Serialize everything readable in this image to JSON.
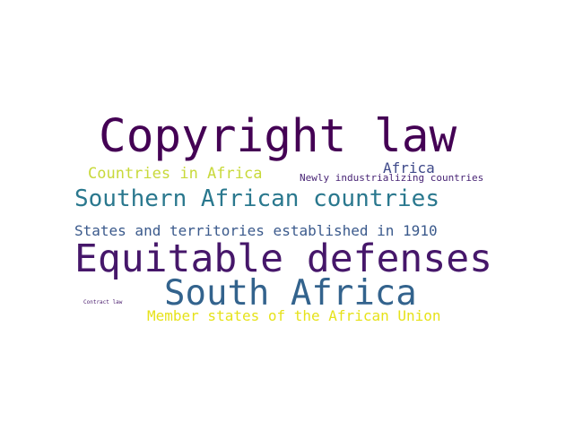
{
  "words": {
    "copyright_law": {
      "text": "Copyright law",
      "color": "#440154"
    },
    "countries_in_africa": {
      "text": "Countries in Africa",
      "color": "#c8d93a"
    },
    "africa": {
      "text": "Africa",
      "color": "#3f4a8a"
    },
    "newly_industrializing": {
      "text": "Newly industrializing countries",
      "color": "#482475"
    },
    "southern_african": {
      "text": "Southern African countries",
      "color": "#2a788e"
    },
    "states_territories": {
      "text": "States and territories established in 1910",
      "color": "#3b5a8c"
    },
    "equitable_defenses": {
      "text": "Equitable defenses",
      "color": "#46176a"
    },
    "south_africa": {
      "text": "South Africa",
      "color": "#33638d"
    },
    "contract_law": {
      "text": "Contract law",
      "color": "#481a6c"
    },
    "member_states": {
      "text": "Member states of the African Union",
      "color": "#e6e21a"
    }
  }
}
